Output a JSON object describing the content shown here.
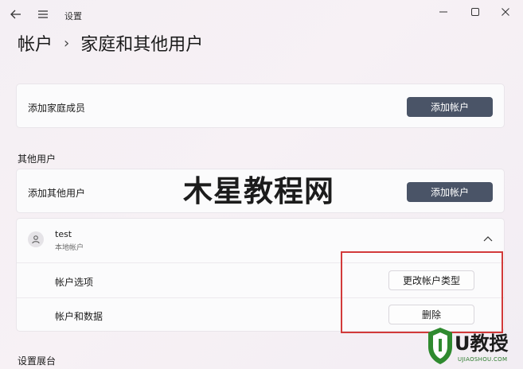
{
  "window": {
    "title": "设置"
  },
  "breadcrumb": {
    "parent": "帐户",
    "separator": "›",
    "current": "家庭和其他用户"
  },
  "family": {
    "label": "添加家庭成员",
    "button": "添加帐户"
  },
  "other_users": {
    "heading": "其他用户",
    "label": "添加其他用户",
    "button": "添加帐户"
  },
  "user": {
    "name": "test",
    "type": "本地帐户",
    "options_label": "帐户选项",
    "change_type_button": "更改帐户类型",
    "data_label": "帐户和数据",
    "delete_button": "删除"
  },
  "kiosk": {
    "heading": "设置展台"
  },
  "watermark": {
    "text": "木星教程网"
  },
  "logo": {
    "text": "U教授",
    "subtext": "UJIAOSHOU.COM"
  },
  "colors": {
    "primary_button": "#4a5467",
    "highlight": "#d23a3a",
    "logo_green": "#2a7a2a"
  }
}
